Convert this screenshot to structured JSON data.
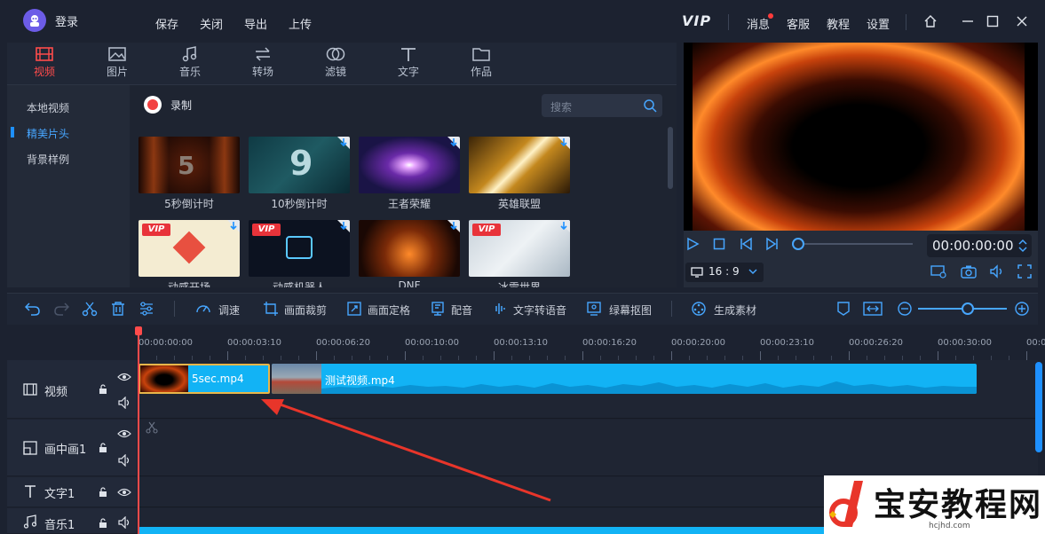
{
  "titlebar": {
    "login": "登录",
    "menu": [
      "保存",
      "关闭",
      "导出",
      "上传"
    ],
    "vip": "VIP",
    "links": [
      "消息",
      "客服",
      "教程",
      "设置"
    ]
  },
  "tabs": [
    "视频",
    "图片",
    "音乐",
    "转场",
    "滤镜",
    "文字",
    "作品"
  ],
  "categories": [
    "本地视频",
    "精美片头",
    "背景样例"
  ],
  "record": {
    "label": "录制"
  },
  "search": {
    "placeholder": "搜索"
  },
  "thumbnails": [
    {
      "label": "5秒倒计时",
      "digit": "5"
    },
    {
      "label": "10秒倒计时",
      "digit": "9"
    },
    {
      "label": "王者荣耀"
    },
    {
      "label": "英雄联盟"
    },
    {
      "label": "动感开场",
      "badge": "VIP"
    },
    {
      "label": "动感机器人",
      "badge": "VIP"
    },
    {
      "label": "DNF"
    },
    {
      "label": "冰雪世界",
      "badge": "VIP"
    }
  ],
  "preview": {
    "timecode": "00:00:00:00",
    "ratio": "16 : 9",
    "progress": 0
  },
  "toolbar": {
    "tools": [
      "调速",
      "画面裁剪",
      "画面定格",
      "配音",
      "文字转语音",
      "绿幕抠图",
      "生成素材"
    ]
  },
  "ruler": {
    "ticks": [
      "00:00:00:00",
      "00:00:03:10",
      "00:00:06:20",
      "00:00:10:00",
      "00:00:13:10",
      "00:00:16:20",
      "00:00:20:00",
      "00:00:23:10",
      "00:00:26:20",
      "00:00:30:00",
      "00:0"
    ]
  },
  "tracks": {
    "video": "视频",
    "pip": "画中画1",
    "text": "文字1",
    "music": "音乐1"
  },
  "clips": [
    {
      "name": "5sec.mp4"
    },
    {
      "name": "测试视频.mp4"
    }
  ],
  "watermark": {
    "title": "宝安教程网",
    "url": "hcjhd.com"
  },
  "colors": {
    "accent": "#ff4b4b",
    "clip": "#12b3f5",
    "active_category": "#47a6ff"
  }
}
